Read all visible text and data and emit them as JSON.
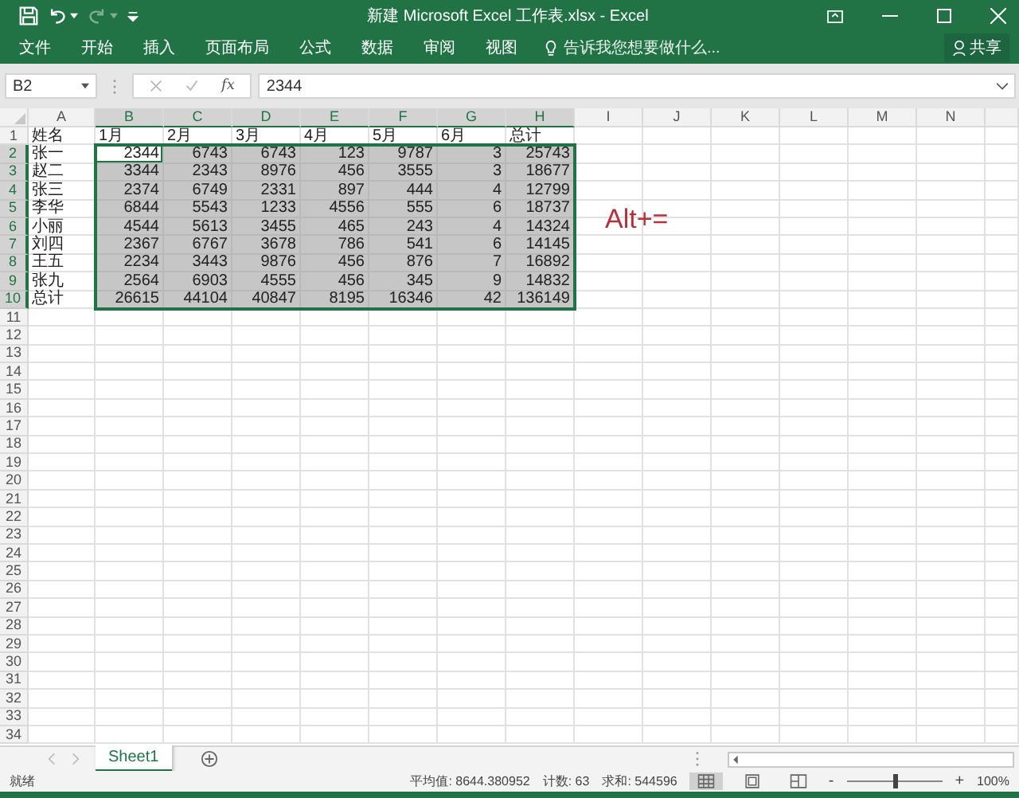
{
  "window": {
    "title": "新建 Microsoft Excel 工作表.xlsx - Excel"
  },
  "ribbon_tabs": [
    {
      "label": "文件",
      "selected": false
    },
    {
      "label": "开始",
      "selected": false
    },
    {
      "label": "插入",
      "selected": false
    },
    {
      "label": "页面布局",
      "selected": false
    },
    {
      "label": "公式",
      "selected": false
    },
    {
      "label": "数据",
      "selected": false
    },
    {
      "label": "审阅",
      "selected": false
    },
    {
      "label": "视图",
      "selected": false
    }
  ],
  "tell_me": {
    "placeholder": "告诉我您想要做什么..."
  },
  "share_button": {
    "label": "共享"
  },
  "formula_bar": {
    "name_box": "B2",
    "fx": "fx",
    "value": "2344"
  },
  "sheet": {
    "column_headers": [
      {
        "label": "A",
        "selected": false
      },
      {
        "label": "B",
        "selected": true
      },
      {
        "label": "C",
        "selected": true
      },
      {
        "label": "D",
        "selected": true
      },
      {
        "label": "E",
        "selected": true
      },
      {
        "label": "F",
        "selected": true
      },
      {
        "label": "G",
        "selected": true
      },
      {
        "label": "H",
        "selected": true
      },
      {
        "label": "I",
        "selected": false
      },
      {
        "label": "J",
        "selected": false
      },
      {
        "label": "K",
        "selected": false
      },
      {
        "label": "L",
        "selected": false
      },
      {
        "label": "M",
        "selected": false
      },
      {
        "label": "N",
        "selected": false
      }
    ],
    "row_headers": [
      {
        "label": "1",
        "selected": false
      },
      {
        "label": "2",
        "selected": true
      },
      {
        "label": "3",
        "selected": true
      },
      {
        "label": "4",
        "selected": true
      },
      {
        "label": "5",
        "selected": true
      },
      {
        "label": "6",
        "selected": true
      },
      {
        "label": "7",
        "selected": true
      },
      {
        "label": "8",
        "selected": true
      },
      {
        "label": "9",
        "selected": true
      },
      {
        "label": "10",
        "selected": true
      },
      {
        "label": "11",
        "selected": false
      },
      {
        "label": "12",
        "selected": false
      },
      {
        "label": "13",
        "selected": false
      },
      {
        "label": "14",
        "selected": false
      },
      {
        "label": "15",
        "selected": false
      },
      {
        "label": "16",
        "selected": false
      },
      {
        "label": "17",
        "selected": false
      },
      {
        "label": "18",
        "selected": false
      },
      {
        "label": "19",
        "selected": false
      },
      {
        "label": "20",
        "selected": false
      },
      {
        "label": "21",
        "selected": false
      },
      {
        "label": "22",
        "selected": false
      },
      {
        "label": "23",
        "selected": false
      },
      {
        "label": "24",
        "selected": false
      },
      {
        "label": "25",
        "selected": false
      },
      {
        "label": "26",
        "selected": false
      },
      {
        "label": "27",
        "selected": false
      },
      {
        "label": "28",
        "selected": false
      },
      {
        "label": "29",
        "selected": false
      },
      {
        "label": "30",
        "selected": false
      },
      {
        "label": "31",
        "selected": false
      },
      {
        "label": "32",
        "selected": false
      },
      {
        "label": "33",
        "selected": false
      },
      {
        "label": "34",
        "selected": false
      }
    ],
    "rows": [
      {
        "kind": "header",
        "cells": [
          {
            "v": "姓名",
            "selected": false,
            "active": false
          },
          {
            "v": "1月",
            "selected": false,
            "active": false
          },
          {
            "v": "2月",
            "selected": false,
            "active": false
          },
          {
            "v": "3月",
            "selected": false,
            "active": false
          },
          {
            "v": "4月",
            "selected": false,
            "active": false
          },
          {
            "v": "5月",
            "selected": false,
            "active": false
          },
          {
            "v": "6月",
            "selected": false,
            "active": false
          },
          {
            "v": "总计",
            "selected": false,
            "active": false
          }
        ]
      },
      {
        "kind": "data",
        "cells": [
          {
            "v": "张一",
            "selected": false,
            "active": false
          },
          {
            "v": "2344",
            "selected": true,
            "active": true
          },
          {
            "v": "6743",
            "selected": true,
            "active": false
          },
          {
            "v": "6743",
            "selected": true,
            "active": false
          },
          {
            "v": "123",
            "selected": true,
            "active": false
          },
          {
            "v": "9787",
            "selected": true,
            "active": false
          },
          {
            "v": "3",
            "selected": true,
            "active": false
          },
          {
            "v": "25743",
            "selected": true,
            "active": false
          }
        ]
      },
      {
        "kind": "data",
        "cells": [
          {
            "v": "赵二",
            "selected": false,
            "active": false
          },
          {
            "v": "3344",
            "selected": true,
            "active": false
          },
          {
            "v": "2343",
            "selected": true,
            "active": false
          },
          {
            "v": "8976",
            "selected": true,
            "active": false
          },
          {
            "v": "456",
            "selected": true,
            "active": false
          },
          {
            "v": "3555",
            "selected": true,
            "active": false
          },
          {
            "v": "3",
            "selected": true,
            "active": false
          },
          {
            "v": "18677",
            "selected": true,
            "active": false
          }
        ]
      },
      {
        "kind": "data",
        "cells": [
          {
            "v": "张三",
            "selected": false,
            "active": false
          },
          {
            "v": "2374",
            "selected": true,
            "active": false
          },
          {
            "v": "6749",
            "selected": true,
            "active": false
          },
          {
            "v": "2331",
            "selected": true,
            "active": false
          },
          {
            "v": "897",
            "selected": true,
            "active": false
          },
          {
            "v": "444",
            "selected": true,
            "active": false
          },
          {
            "v": "4",
            "selected": true,
            "active": false
          },
          {
            "v": "12799",
            "selected": true,
            "active": false
          }
        ]
      },
      {
        "kind": "data",
        "cells": [
          {
            "v": "李华",
            "selected": false,
            "active": false
          },
          {
            "v": "6844",
            "selected": true,
            "active": false
          },
          {
            "v": "5543",
            "selected": true,
            "active": false
          },
          {
            "v": "1233",
            "selected": true,
            "active": false
          },
          {
            "v": "4556",
            "selected": true,
            "active": false
          },
          {
            "v": "555",
            "selected": true,
            "active": false
          },
          {
            "v": "6",
            "selected": true,
            "active": false
          },
          {
            "v": "18737",
            "selected": true,
            "active": false
          }
        ]
      },
      {
        "kind": "data",
        "cells": [
          {
            "v": "小丽",
            "selected": false,
            "active": false
          },
          {
            "v": "4544",
            "selected": true,
            "active": false
          },
          {
            "v": "5613",
            "selected": true,
            "active": false
          },
          {
            "v": "3455",
            "selected": true,
            "active": false
          },
          {
            "v": "465",
            "selected": true,
            "active": false
          },
          {
            "v": "243",
            "selected": true,
            "active": false
          },
          {
            "v": "4",
            "selected": true,
            "active": false
          },
          {
            "v": "14324",
            "selected": true,
            "active": false
          }
        ]
      },
      {
        "kind": "data",
        "cells": [
          {
            "v": "刘四",
            "selected": false,
            "active": false
          },
          {
            "v": "2367",
            "selected": true,
            "active": false
          },
          {
            "v": "6767",
            "selected": true,
            "active": false
          },
          {
            "v": "3678",
            "selected": true,
            "active": false
          },
          {
            "v": "786",
            "selected": true,
            "active": false
          },
          {
            "v": "541",
            "selected": true,
            "active": false
          },
          {
            "v": "6",
            "selected": true,
            "active": false
          },
          {
            "v": "14145",
            "selected": true,
            "active": false
          }
        ]
      },
      {
        "kind": "data",
        "cells": [
          {
            "v": "王五",
            "selected": false,
            "active": false
          },
          {
            "v": "2234",
            "selected": true,
            "active": false
          },
          {
            "v": "3443",
            "selected": true,
            "active": false
          },
          {
            "v": "9876",
            "selected": true,
            "active": false
          },
          {
            "v": "456",
            "selected": true,
            "active": false
          },
          {
            "v": "876",
            "selected": true,
            "active": false
          },
          {
            "v": "7",
            "selected": true,
            "active": false
          },
          {
            "v": "16892",
            "selected": true,
            "active": false
          }
        ]
      },
      {
        "kind": "data",
        "cells": [
          {
            "v": "张九",
            "selected": false,
            "active": false
          },
          {
            "v": "2564",
            "selected": true,
            "active": false
          },
          {
            "v": "6903",
            "selected": true,
            "active": false
          },
          {
            "v": "4555",
            "selected": true,
            "active": false
          },
          {
            "v": "456",
            "selected": true,
            "active": false
          },
          {
            "v": "345",
            "selected": true,
            "active": false
          },
          {
            "v": "9",
            "selected": true,
            "active": false
          },
          {
            "v": "14832",
            "selected": true,
            "active": false
          }
        ]
      },
      {
        "kind": "data",
        "cells": [
          {
            "v": "总计",
            "selected": false,
            "active": false
          },
          {
            "v": "26615",
            "selected": true,
            "active": false
          },
          {
            "v": "44104",
            "selected": true,
            "active": false
          },
          {
            "v": "40847",
            "selected": true,
            "active": false
          },
          {
            "v": "8195",
            "selected": true,
            "active": false
          },
          {
            "v": "16346",
            "selected": true,
            "active": false
          },
          {
            "v": "42",
            "selected": true,
            "active": false
          },
          {
            "v": "136149",
            "selected": true,
            "active": false
          }
        ]
      }
    ],
    "annotation": "Alt+="
  },
  "sheet_tabs": [
    {
      "label": "Sheet1",
      "selected": true
    }
  ],
  "status_bar": {
    "status": "就绪",
    "average": "平均值: 8644.380952",
    "count": "计数: 63",
    "sum": "求和: 544596",
    "views": [
      {
        "kind": "normal",
        "selected": true
      },
      {
        "kind": "layout",
        "selected": false
      },
      {
        "kind": "pagebreak",
        "selected": false
      }
    ],
    "zoom": {
      "minus": "-",
      "plus": "+",
      "level": 0.5,
      "value": "100%"
    }
  }
}
